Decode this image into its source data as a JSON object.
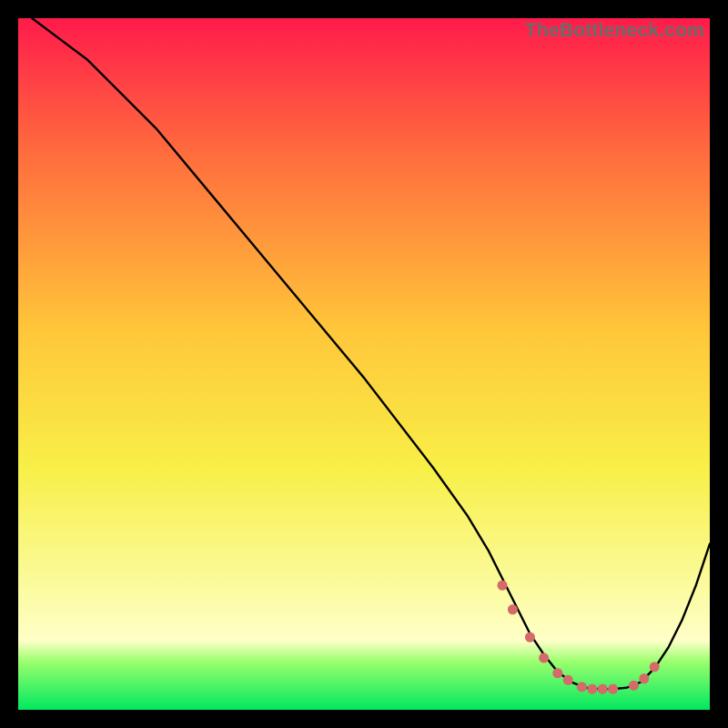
{
  "watermark": "TheBottleneck.com",
  "colors": {
    "bg": "#000000",
    "grad_top": "#ff1b4b",
    "grad_mid1": "#ff6e3d",
    "grad_mid2": "#ffc63a",
    "grad_mid3": "#f8ef47",
    "grad_mid4": "#fbfb9d",
    "grad_bottom_yellow": "#ffffc8",
    "grad_green_top": "#9bff6e",
    "grad_green_bottom": "#00e85f",
    "line": "#000000",
    "marker": "#d46a6a"
  },
  "chart_data": {
    "type": "line",
    "title": "",
    "xlabel": "",
    "ylabel": "",
    "xlim": [
      0,
      100
    ],
    "ylim": [
      0,
      100
    ],
    "series": [
      {
        "name": "curve",
        "x": [
          2,
          6,
          10,
          20,
          30,
          40,
          50,
          60,
          65,
          68,
          70,
          72,
          74,
          76,
          78,
          80,
          82,
          84,
          86,
          88,
          90,
          92,
          94,
          96,
          98,
          100
        ],
        "y": [
          100,
          97,
          94,
          84,
          72,
          60,
          48,
          35,
          28,
          23,
          19,
          15,
          11,
          8,
          5.5,
          4,
          3.2,
          3,
          3,
          3.2,
          4,
          6,
          9,
          13,
          18,
          24
        ]
      }
    ],
    "markers": {
      "name": "highlight-band",
      "x": [
        70,
        71.5,
        74,
        76,
        78,
        79.5,
        81.5,
        83,
        84.5,
        86,
        89,
        90.5,
        92
      ],
      "y": [
        18,
        14.5,
        10.5,
        7.5,
        5.3,
        4.3,
        3.3,
        3,
        3,
        3,
        3.5,
        4.5,
        6.2
      ]
    }
  }
}
